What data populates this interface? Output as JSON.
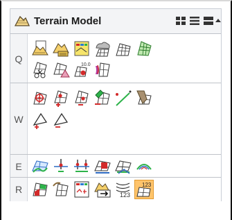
{
  "panel": {
    "title": "Terrain Model",
    "title_icon": "terrain-model-icon",
    "header_buttons": [
      "grid-view-icon",
      "list-view-icon",
      "bar-view-icon",
      "collapse-icon"
    ]
  },
  "groups": [
    {
      "label": "Q",
      "tools": [
        "create-from-file-icon",
        "create-from-elements-icon",
        "create-from-graphical-filter-icon",
        "create-from-point-cloud-icon",
        "create-by-clipping-icon",
        "create-from-complex-terrain-icon",
        "create-delta-icon",
        "create-from-boundary-icon",
        "create-from-text-icon",
        "create-accumulated-icon"
      ]
    },
    {
      "label": "W",
      "tools": [
        "add-features-icon",
        "add-points-icon",
        "remove-features-icon",
        "edit-features-icon",
        "line-between-points-icon",
        "merge-terrain-icon",
        "triangle-add-icon",
        "triangle-delete-icon"
      ]
    },
    {
      "label": "E",
      "tools": [
        "terrain-surface-icon",
        "point-element-icon",
        "multi-point-icon",
        "spot-elevation-icon",
        "terrain-profile-icon",
        "contour-peak-icon"
      ]
    },
    {
      "label": "R",
      "tools": [
        "color-terrain-icon",
        "rotate-terrain-icon",
        "report-icon",
        "export-terrain-icon",
        "label-contours-icon",
        "label-elevations-icon"
      ]
    }
  ],
  "colors": {
    "active_tool": "#ffc46b",
    "panel_bg": "#f3f4f6",
    "accent_green": "#2db34a",
    "accent_red": "#d32a2a"
  }
}
